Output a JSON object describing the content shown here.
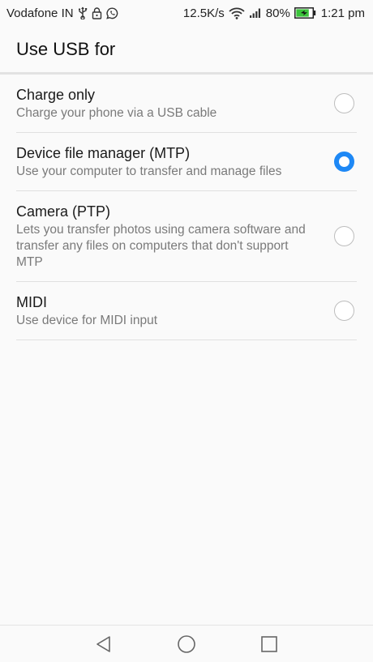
{
  "status_bar": {
    "carrier": "Vodafone IN",
    "network_speed": "12.5K/s",
    "battery_percent": "80%",
    "battery_level": 0.8,
    "time": "1:21 pm",
    "icons": [
      "usb-icon",
      "lock-icon",
      "whatsapp-icon",
      "wifi-icon",
      "signal-icon",
      "battery-icon"
    ]
  },
  "header": {
    "title": "Use USB for"
  },
  "options": [
    {
      "title": "Charge only",
      "subtitle": "Charge your phone via a USB cable",
      "selected": false
    },
    {
      "title": "Device file manager (MTP)",
      "subtitle": "Use your computer to transfer and manage files",
      "selected": true
    },
    {
      "title": "Camera (PTP)",
      "subtitle": "Lets you transfer photos using camera software and transfer any files on computers that don't support MTP",
      "selected": false
    },
    {
      "title": "MIDI",
      "subtitle": "Use device for MIDI input",
      "selected": false
    }
  ],
  "nav": {
    "icons": [
      "back-icon",
      "home-icon",
      "recents-icon"
    ]
  },
  "colors": {
    "accent": "#1e88f5",
    "background": "#fafafa",
    "battery": "#3bc43b"
  }
}
